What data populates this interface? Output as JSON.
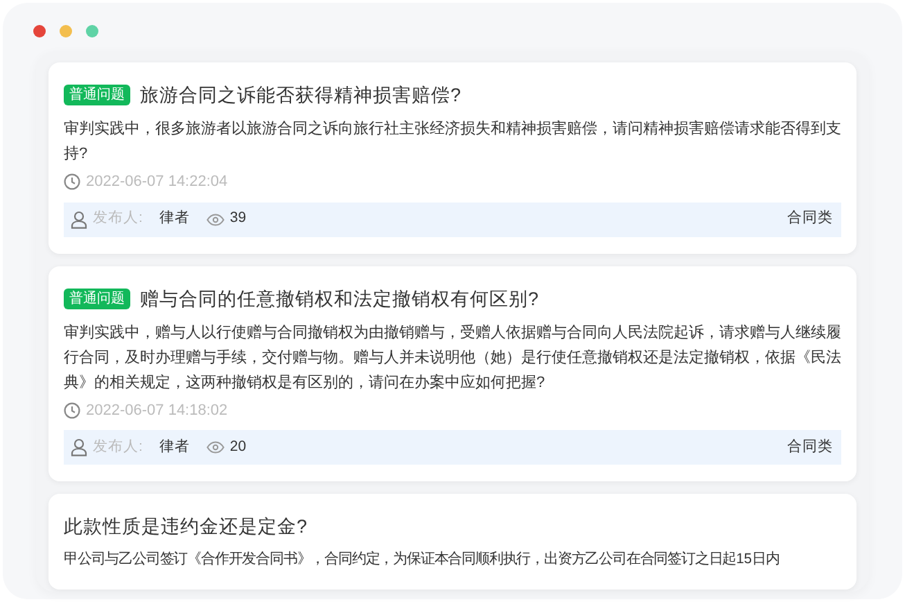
{
  "window": {
    "controls": [
      {
        "color": "#e5453b"
      },
      {
        "color": "#f3be4e"
      },
      {
        "color": "#5fd3a6"
      }
    ]
  },
  "questions": [
    {
      "tag": "普通问题",
      "title": "旅游合同之诉能否获得精神损害赔偿?",
      "body": "审判实践中，很多旅游者以旅游合同之诉向旅行社主张经济损失和精神损害赔偿，请问精神损害赔偿请求能否得到支持?",
      "time": "2022-06-07 14:22:04",
      "publisher_label": "发布人:",
      "publisher": "律者",
      "views": "39",
      "category": "合同类"
    },
    {
      "tag": "普通问题",
      "title": "赠与合同的任意撤销权和法定撤销权有何区别?",
      "body": "审判实践中，赠与人以行使赠与合同撤销权为由撤销赠与，受赠人依据赠与合同向人民法院起诉，请求赠与人继续履行合同，及时办理赠与手续，交付赠与物。赠与人并未说明他（她）是行使任意撤销权还是法定撤销权，依据《民法典》的相关规定，这两种撤销权是有区别的，请问在办案中应如何把握?",
      "time": "2022-06-07 14:18:02",
      "publisher_label": "发布人:",
      "publisher": "律者",
      "views": "20",
      "category": "合同类"
    },
    {
      "title": "此款性质是违约金还是定金?",
      "body": "甲公司与乙公司签订《合作开发合同书》，合同约定，为保证本合同顺利执行，出资方乙公司在合同签订之日起15日内"
    }
  ]
}
